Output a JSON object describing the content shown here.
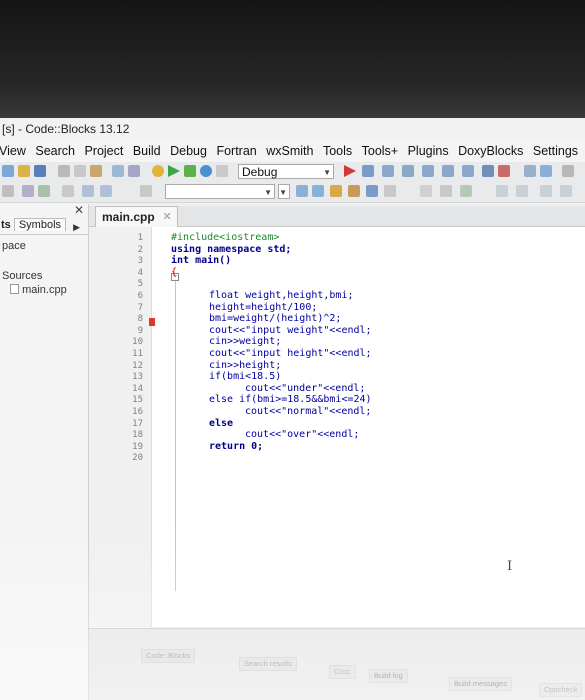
{
  "window": {
    "title": "[s] - Code::Blocks 13.12"
  },
  "menu": [
    "View",
    "Search",
    "Project",
    "Build",
    "Debug",
    "Fortran",
    "wxSmith",
    "Tools",
    "Tools+",
    "Plugins",
    "DoxyBlocks",
    "Settings"
  ],
  "toolbar": {
    "build_target": "Debug"
  },
  "left_panel": {
    "tab_partial": "ts",
    "tab_symbols": "Symbols",
    "workspace": "pace",
    "sources": "Sources",
    "file": "main.cpp"
  },
  "editor": {
    "tab_label": "main.cpp",
    "line_numbers": [
      "1",
      "2",
      "3",
      "4",
      "5",
      "6",
      "7",
      "8",
      "9",
      "10",
      "11",
      "12",
      "13",
      "14",
      "15",
      "16",
      "17",
      "18",
      "19",
      "20"
    ],
    "lines": [
      "#include<iostream>",
      "using namespace std;",
      "int main()",
      "{",
      "float weight,height,bmi;",
      "height=height/100;",
      "bmi=weight/(height)^2;",
      "cout<<\"input weight\"<<endl;",
      "cin>>weight;",
      "cout<<\"input height\"<<endl;",
      "cin>>height;",
      "if(bmi<18.5)",
      "cout<<\"under\"<<endl;",
      "else if(bmi>=18.5&&bmi<=24)",
      "cout<<\"normal\"<<endl;",
      "else",
      "cout<<\"over\"<<endl;",
      "return 0;"
    ]
  },
  "log_tabs": [
    "Code::Blocks",
    "Search results",
    "Cccc",
    "Build log",
    "Build messages",
    "Cppcheck"
  ],
  "colors": {
    "keyword": "#00008b",
    "preprocessor": "#1e8a2c",
    "string": "#0000ff",
    "number": "#e07a2f",
    "breakpoint": "#d93a2c"
  }
}
